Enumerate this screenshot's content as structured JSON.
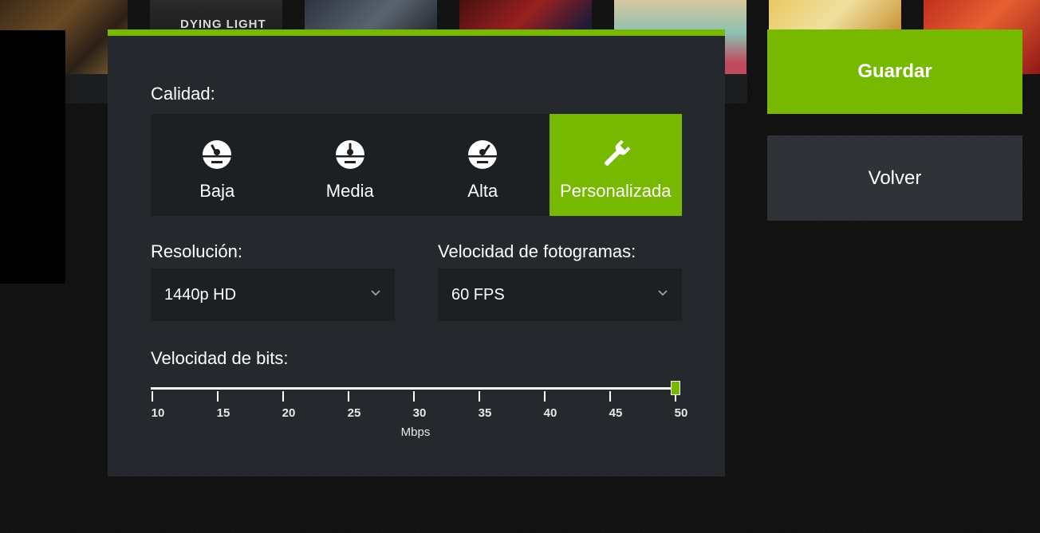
{
  "dialog": {
    "quality_label": "Calidad:",
    "quality_options": [
      {
        "label": "Baja",
        "icon": "gauge-low-icon",
        "selected": false
      },
      {
        "label": "Media",
        "icon": "gauge-medium-icon",
        "selected": false
      },
      {
        "label": "Alta",
        "icon": "gauge-high-icon",
        "selected": false
      },
      {
        "label": "Personalizada",
        "icon": "wrench-icon",
        "selected": true
      }
    ],
    "resolution_label": "Resolución:",
    "resolution_value": "1440p HD",
    "framerate_label": "Velocidad de fotogramas:",
    "framerate_value": "60 FPS",
    "bitrate_label": "Velocidad de bits:",
    "bitrate": {
      "ticks": [
        "10",
        "15",
        "20",
        "25",
        "30",
        "35",
        "40",
        "45",
        "50"
      ],
      "unit": "Mbps",
      "min": 10,
      "max": 50,
      "value": 50
    }
  },
  "buttons": {
    "save": "Guardar",
    "back": "Volver"
  },
  "background": {
    "game_tile_text": "DYING LIGHT"
  },
  "colors": {
    "accent": "#76b900",
    "dialog_bg": "#25292d",
    "control_bg": "#1d2023",
    "secondary_button": "#2f3338"
  }
}
